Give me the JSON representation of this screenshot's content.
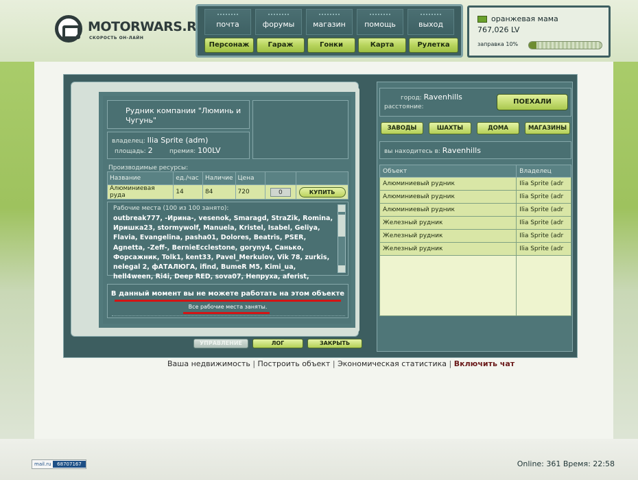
{
  "header": {
    "logo_text": "MOTORWARS.RU",
    "logo_sub": "СКОРОСТЬ ОН-ЛАЙН",
    "nav_top": [
      "почта",
      "форумы",
      "магазин",
      "помощь",
      "выход"
    ],
    "nav_bottom": [
      "Персонаж",
      "Гараж",
      "Гонки",
      "Карта",
      "Рулетка"
    ]
  },
  "user": {
    "name": "оранжевая мама",
    "money": "767,026 LV",
    "fuel_label": "заправка 10%",
    "fuel_percent": 10,
    "flag_color": "#6aa12c"
  },
  "building": {
    "title": "Рудник компании \"Люминь и Чугунь\"",
    "owner_label": "владелец:",
    "owner_value": "Ilia Sprite (adm)",
    "area_label": "площадь:",
    "area_value": "2",
    "bonus_label": "премия:",
    "bonus_value": "100LV",
    "resources_label": "Производимые ресурсы:",
    "table_headers": [
      "Название",
      "ед./час",
      "Наличие",
      "Цена",
      ""
    ],
    "table_row": {
      "name": "Алюминиевая руда",
      "per_hour": "14",
      "stock": "84",
      "price": "720",
      "qty": "0",
      "buy_label": "КУПИТЬ"
    },
    "workers_title": "Рабочие места (100 из 100 занято):",
    "workers_list": "outbreak777, -Ирина-, vesenok, Smaragd, StraZik, Romina, Иришка23, stormywolf, Manuela, Kristel, Isabel, Geliya, Flavia, Evangelina, pasha01, Dolores, Beatris, PSER, Agnetta, -Zeff-, BernieEcclestone, goryny4, Санько, Форсажник, Tolk1, kent33, Pavel_Merkulov, Vik 78, zurkis, nelegal 2, фАТАЛЮГА, ifind, BumeR M5, Kimi_ua, hell4ween, Ri4i, Deep RED, sova07, Непруха, aferist,",
    "warning": "В данный момент вы не можете работать на этом объекте",
    "warning_sub": "Все рабочие места заняты.",
    "underline_color": "#d41414"
  },
  "actions": {
    "manage": "УПРАВЛЕНИЕ",
    "log": "ЛОГ",
    "close": "ЗАКРЫТЬ"
  },
  "city": {
    "city_label": "город:",
    "city_value": "Ravenhills",
    "distance_label": "расстояние:",
    "go_label": "ПОЕХАЛИ",
    "categories": [
      "ЗАВОДЫ",
      "ШАХТЫ",
      "ДОМА",
      "МАГАЗИНЫ"
    ],
    "location_label": "вы находитесь в:",
    "location_value": "Ravenhills",
    "objects_headers": [
      "Объект",
      "Владелец"
    ],
    "objects": [
      {
        "name": "Алюминиевый рудник",
        "owner": "Ilia Sprite (adr"
      },
      {
        "name": "Алюминиевый рудник",
        "owner": "Ilia Sprite (adr"
      },
      {
        "name": "Алюминиевый рудник",
        "owner": "Ilia Sprite (adr"
      },
      {
        "name": "Железный рудник",
        "owner": "Ilia Sprite (adr"
      },
      {
        "name": "Железный рудник",
        "owner": "Ilia Sprite (adr"
      },
      {
        "name": "Железный рудник",
        "owner": "Ilia Sprite (adr"
      }
    ]
  },
  "links": {
    "realty": "Ваша недвижимость",
    "build": "Построить объект",
    "stats": "Экономическая статистика",
    "chat": "Включить чат",
    "separator": "|"
  },
  "footer": {
    "mailru_label": "mail.ru",
    "mailru_counter": "68707167",
    "online": "Online: 361  Время: 22:58"
  }
}
